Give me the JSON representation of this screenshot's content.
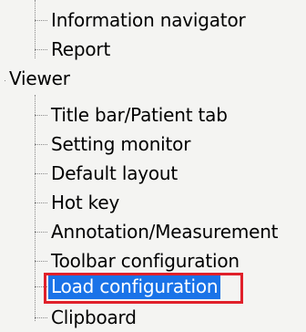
{
  "tree": {
    "report_group_items": [
      {
        "label": "Information navigator"
      },
      {
        "label": "Report"
      }
    ],
    "viewer": {
      "label": "Viewer",
      "items": [
        {
          "label": "Title bar/Patient tab"
        },
        {
          "label": "Setting monitor"
        },
        {
          "label": "Default layout"
        },
        {
          "label": "Hot key"
        },
        {
          "label": "Annotation/Measurement"
        },
        {
          "label": "Toolbar configuration"
        },
        {
          "label": "Load configuration"
        },
        {
          "label": "Clipboard"
        }
      ]
    },
    "selected_item": "Load configuration",
    "colors": {
      "selection_bg": "#1a73e8",
      "highlight_border": "#e0202a",
      "connector": "#8a8a8a"
    }
  }
}
